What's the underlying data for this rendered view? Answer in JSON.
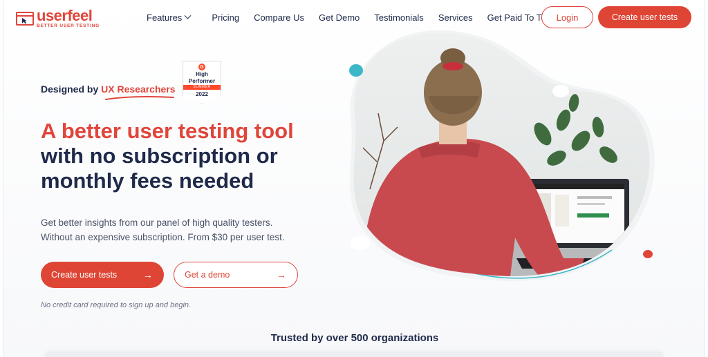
{
  "brand": {
    "name": "userfeel",
    "tagline": "BETTER USER TESTING",
    "color": "#e0453a"
  },
  "nav": {
    "items": [
      {
        "label": "Features",
        "has_dropdown": true
      },
      {
        "label": "Pricing"
      },
      {
        "label": "Compare Us"
      },
      {
        "label": "Get Demo"
      },
      {
        "label": "Testimonials"
      },
      {
        "label": "Services"
      },
      {
        "label": "Get Paid To Test"
      }
    ],
    "login_label": "Login",
    "cta_label": "Create user tests"
  },
  "hero": {
    "designed_prefix": "Designed by ",
    "designed_accent": "UX Researchers",
    "badge": {
      "logo": "G",
      "line1": "High",
      "line2": "Performer",
      "season": "SUMMER",
      "year": "2022"
    },
    "headline_red": "A better user testing tool",
    "headline_line2": "with no subscription or",
    "headline_line3": "monthly fees needed",
    "sub_line1": "Get better insights from our panel of high quality testers.",
    "sub_line2": "Without an expensive subscription. From $30 per user test.",
    "primary_cta": "Create user tests",
    "secondary_cta": "Get a demo",
    "arrow": "→",
    "note": "No credit card required to sign up and begin."
  },
  "trusted": "Trusted by over 500 organizations",
  "colors": {
    "accent": "#de4535",
    "navy": "#1f2a4a",
    "teal": "#3bb7c8"
  }
}
